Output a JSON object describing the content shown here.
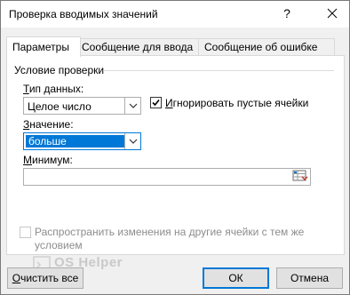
{
  "window": {
    "title": "Проверка вводимых значений",
    "help_glyph": "?"
  },
  "tabs": [
    {
      "label": "Параметры",
      "active": true
    },
    {
      "label": "Сообщение для ввода",
      "active": false
    },
    {
      "label": "Сообщение об ошибке",
      "active": false
    }
  ],
  "validation": {
    "group_title": "Условие проверки",
    "data_type_label_prefix": "Т",
    "data_type_label_rest": "ип данных:",
    "data_type_value": "Целое число",
    "ignore_blank_label_prefix": "И",
    "ignore_blank_label_rest": "гнорировать пустые ячейки",
    "ignore_blank_checked": true,
    "operator_label_prefix": "З",
    "operator_label_rest": "начение:",
    "operator_value": "больше",
    "minimum_label_prefix": "М",
    "minimum_label_rest": "инимум:",
    "minimum_value": "",
    "apply_all_line1": "Распространить изменения на другие ячейки с тем же",
    "apply_all_line2": "условием",
    "apply_all_checked": false,
    "apply_all_enabled": false
  },
  "footer": {
    "clear_all_prefix": "О",
    "clear_all_rest": "чистить все",
    "ok_label": "ОК",
    "cancel_label": "Отмена"
  },
  "watermark": {
    "text": "OS Helper"
  },
  "colors": {
    "accent": "#0078d7",
    "dialog_bg": "#f0f0f0",
    "panel_bg": "#ffffff",
    "disabled_text": "#8d8d8d"
  }
}
